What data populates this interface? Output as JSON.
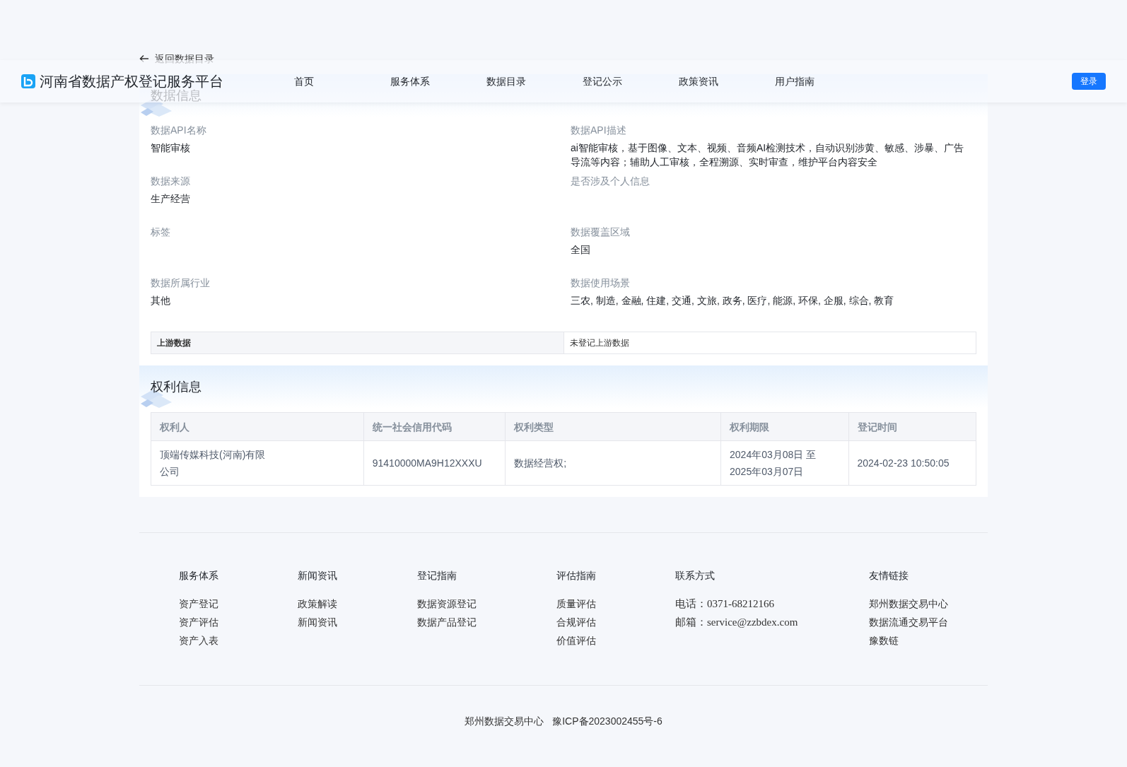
{
  "header": {
    "logo_text": "河南省数据产权登记服务平台",
    "nav": [
      "首页",
      "服务体系",
      "数据目录",
      "登记公示",
      "政策资讯",
      "用户指南"
    ],
    "login_button": "登录"
  },
  "back_link": "返回数据目录",
  "data_info": {
    "title": "数据信息",
    "fields": [
      {
        "label": "数据API名称",
        "value": "智能审核"
      },
      {
        "label": "数据API描述",
        "value": "ai智能审核，基于图像、文本、视频、音频AI检测技术，自动识别涉黄、敏感、涉暴、广告导流等内容；辅助人工审核，全程溯源、实时审查，维护平台内容安全"
      },
      {
        "label": "数据来源",
        "value": "生产经营"
      },
      {
        "label": "是否涉及个人信息"
      },
      {
        "label": "标签"
      },
      {
        "label": "数据覆盖区域",
        "value": "全国"
      },
      {
        "label": "数据所属行业",
        "value": "其他"
      },
      {
        "label": "数据使用场景",
        "value": "三农, 制造, 金融, 住建, 交通, 文旅, 政务, 医疗, 能源, 环保, 企服, 综合, 教育"
      }
    ],
    "upstream": {
      "label": "上游数据",
      "value": "未登记上游数据"
    }
  },
  "rights_info": {
    "title": "权利信息",
    "table": {
      "columns": [
        "权利人",
        "统一社会信用代码",
        "权利类型",
        "权利期限",
        "登记时间"
      ],
      "rows": [
        [
          "顶端传媒科技(河南)有限公司",
          "91410000MA9H12XXXU",
          "数据经营权;",
          "2024年03月08日 至 2025年03月07日",
          "2024-02-23 10:50:05"
        ]
      ]
    }
  },
  "footer": {
    "columns": [
      {
        "title": "服务体系",
        "items": [
          "资产登记",
          "资产评估",
          "资产入表"
        ]
      },
      {
        "title": "新闻资讯",
        "items": [
          "政策解读",
          "新闻资讯"
        ]
      },
      {
        "title": "登记指南",
        "items": [
          "数据资源登记",
          "数据产品登记"
        ]
      },
      {
        "title": "评估指南",
        "items": [
          "质量评估",
          "合规评估",
          "价值评估"
        ]
      },
      {
        "title": "联系方式",
        "items": [
          "电话：0371-68212166",
          "邮箱：service@zzbdex.com"
        ]
      },
      {
        "title": "友情链接",
        "items": [
          "郑州数据交易中心",
          "数据流通交易平台",
          "豫数链"
        ]
      }
    ],
    "copyright": [
      "郑州数据交易中心",
      "豫ICP备2023002455号-6"
    ]
  }
}
